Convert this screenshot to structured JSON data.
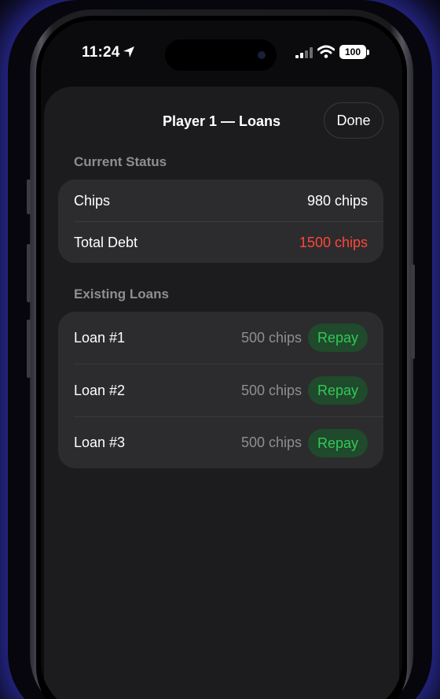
{
  "status_bar": {
    "time": "11:24",
    "battery": "100"
  },
  "sheet": {
    "title": "Player 1 — Loans",
    "done_label": "Done"
  },
  "current_status": {
    "header": "Current Status",
    "chips_label": "Chips",
    "chips_value": "980 chips",
    "debt_label": "Total Debt",
    "debt_value": "1500 chips"
  },
  "existing_loans": {
    "header": "Existing Loans",
    "items": [
      {
        "label": "Loan #1",
        "amount": "500 chips",
        "action": "Repay"
      },
      {
        "label": "Loan #2",
        "amount": "500 chips",
        "action": "Repay"
      },
      {
        "label": "Loan #3",
        "amount": "500 chips",
        "action": "Repay"
      }
    ]
  },
  "colors": {
    "accent_green": "#34c759",
    "debt_red": "#ff453a",
    "sheet_bg": "#1c1c1e",
    "card_bg": "#2c2c2e",
    "glow": "#4646ff"
  }
}
